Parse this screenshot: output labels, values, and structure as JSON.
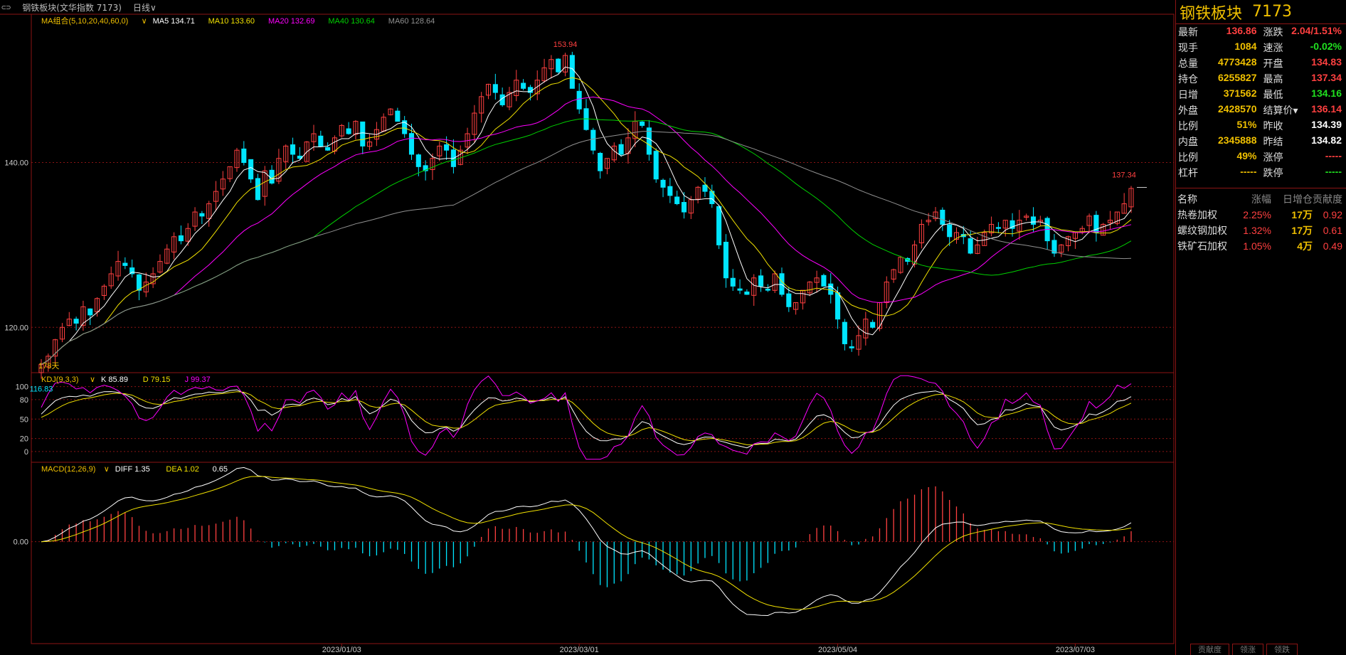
{
  "topbar": {
    "link_icon": "⊂⊃",
    "title": "钢铁板块(文华指数 7173)",
    "period": "日线",
    "period_caret": "∨"
  },
  "colors": {
    "up": "#ff4040",
    "down": "#00e5ff",
    "grid": "#8b1414",
    "ma5": "#ffffff",
    "ma10": "#f0e000",
    "ma20": "#ff00ff",
    "ma40": "#00d000",
    "ma60": "#909090",
    "k": "#ffffff",
    "d": "#f0e000",
    "j": "#ff00ff",
    "diff": "#ffffff",
    "dea": "#f0e000",
    "label_yellow": "#f0c000",
    "label_red": "#ff4040",
    "label_green": "#20e020",
    "label_white": "#ffffff"
  },
  "chart_data": {
    "type": "candlestick",
    "symbol": "钢铁板块",
    "code": "7173",
    "period": "日线",
    "x_ticks": [
      "2023/01/03",
      "2023/03/01",
      "2023/05/04",
      "2023/07/03"
    ],
    "y_ticks": [
      "140.00",
      "120.00"
    ],
    "price_ylim": [
      114.5,
      158
    ],
    "range_label": "178天",
    "annotations": {
      "high": "153.94",
      "low": "116.83",
      "last_high": "137.34"
    },
    "ma_legend": {
      "label": "MA组合(5,10,20,40,60,0)",
      "items": [
        {
          "name": "MA5",
          "value": "134.71",
          "color": "#ffffff"
        },
        {
          "name": "MA10",
          "value": "133.60",
          "color": "#f0e000"
        },
        {
          "name": "MA20",
          "value": "132.69",
          "color": "#ff00ff"
        },
        {
          "name": "MA40",
          "value": "130.64",
          "color": "#00d000"
        },
        {
          "name": "MA60",
          "value": "128.64",
          "color": "#909090"
        }
      ]
    },
    "kdj_legend": {
      "label": "KDJ(9,3,3)",
      "items": [
        {
          "name": "K",
          "value": "85.89",
          "color": "#ffffff"
        },
        {
          "name": "D",
          "value": "79.15",
          "color": "#f0e000"
        },
        {
          "name": "J",
          "value": "99.37",
          "color": "#ff00ff"
        }
      ]
    },
    "kdj_ticks": [
      "100",
      "80",
      "50",
      "20",
      "0"
    ],
    "macd_legend": {
      "label": "MACD(12,26,9)",
      "items": [
        {
          "name": "DIFF",
          "value": "1.35",
          "color": "#ffffff"
        },
        {
          "name": "DEA",
          "value": "1.02",
          "color": "#f0e000"
        },
        {
          "name": "",
          "value": "0.65",
          "color": "#ffffff"
        }
      ]
    },
    "macd_ticks": [
      "0.00"
    ],
    "closes": [
      115.5,
      116.5,
      118.5,
      120.0,
      121.0,
      120.5,
      122.5,
      121.5,
      123.5,
      125.0,
      126.5,
      128.0,
      127.5,
      126.5,
      124.5,
      125.5,
      126.5,
      128.0,
      129.5,
      131.0,
      130.5,
      132.0,
      134.0,
      133.5,
      135.0,
      136.5,
      138.0,
      139.5,
      141.5,
      140.0,
      138.0,
      135.5,
      139.0,
      137.5,
      140.5,
      142.0,
      141.0,
      140.5,
      142.5,
      143.5,
      142.0,
      141.5,
      143.0,
      144.5,
      143.5,
      145.0,
      142.0,
      142.5,
      144.0,
      145.5,
      146.5,
      145.0,
      143.5,
      141.0,
      139.5,
      139.0,
      140.5,
      142.0,
      141.5,
      139.5,
      141.5,
      143.5,
      146.0,
      148.0,
      149.5,
      148.5,
      147.0,
      148.5,
      150.0,
      149.0,
      148.5,
      150.0,
      151.5,
      152.5,
      151.0,
      153.0,
      149.0,
      146.5,
      144.0,
      141.5,
      139.0,
      140.5,
      142.0,
      141.0,
      143.0,
      145.0,
      144.5,
      141.0,
      138.0,
      137.0,
      136.0,
      135.0,
      134.0,
      135.5,
      137.0,
      136.5,
      135.0,
      130.0,
      126.0,
      125.0,
      124.5,
      124.0,
      126.0,
      125.0,
      124.5,
      126.5,
      124.0,
      122.5,
      123.0,
      124.5,
      125.5,
      126.0,
      125.0,
      124.0,
      121.0,
      118.0,
      117.5,
      119.0,
      121.0,
      120.0,
      123.0,
      125.5,
      127.0,
      128.5,
      128.0,
      130.0,
      132.5,
      133.0,
      134.0,
      132.5,
      131.0,
      131.5,
      131.0,
      129.0,
      130.0,
      131.5,
      132.5,
      132.0,
      133.0,
      132.0,
      133.0,
      133.5,
      132.5,
      133.0,
      130.5,
      129.0,
      130.0,
      131.0,
      131.5,
      132.0,
      133.5,
      131.5,
      132.5,
      133.0,
      134.0,
      135.0,
      136.86
    ],
    "kdj_ylim": [
      -10,
      115
    ],
    "macd_ylim": [
      -6.5,
      5.0
    ]
  },
  "quote": {
    "title": "钢铁板块",
    "code": "7173",
    "rows": [
      [
        {
          "k": "最新",
          "v": "136.86",
          "c": "#ff4040"
        },
        {
          "k": "涨跌",
          "v": "2.04/1.51%",
          "c": "#ff4040"
        }
      ],
      [
        {
          "k": "现手",
          "v": "1084",
          "c": "#f0c000"
        },
        {
          "k": "速涨",
          "v": "-0.02%",
          "c": "#20e020"
        }
      ],
      [
        {
          "k": "总量",
          "v": "4773428",
          "c": "#f0c000"
        },
        {
          "k": "开盘",
          "v": "134.83",
          "c": "#ff4040"
        }
      ],
      [
        {
          "k": "持仓",
          "v": "6255827",
          "c": "#f0c000"
        },
        {
          "k": "最高",
          "v": "137.34",
          "c": "#ff4040"
        }
      ],
      [
        {
          "k": "日增",
          "v": "371562",
          "c": "#f0c000"
        },
        {
          "k": "最低",
          "v": "134.16",
          "c": "#20e020"
        }
      ],
      [
        {
          "k": "外盘",
          "v": "2428570",
          "c": "#f0c000"
        },
        {
          "k": "结算价▾",
          "v": "136.14",
          "c": "#ff4040"
        }
      ],
      [
        {
          "k": "比例",
          "v": "51%",
          "c": "#f0c000"
        },
        {
          "k": "昨收",
          "v": "134.39",
          "c": "#ffffff"
        }
      ],
      [
        {
          "k": "内盘",
          "v": "2345888",
          "c": "#f0c000"
        },
        {
          "k": "昨结",
          "v": "134.82",
          "c": "#ffffff"
        }
      ],
      [
        {
          "k": "比例",
          "v": "49%",
          "c": "#f0c000"
        },
        {
          "k": "涨停",
          "v": "-----",
          "c": "#ff4040"
        }
      ],
      [
        {
          "k": "杠杆",
          "v": "-----",
          "c": "#f0c000"
        },
        {
          "k": "跌停",
          "v": "-----",
          "c": "#20e020"
        }
      ]
    ],
    "components_header": [
      "名称",
      "涨幅",
      "日增仓",
      "贡献度"
    ],
    "components": [
      {
        "name": "热卷加权",
        "chg": "2.25%",
        "oi": "17万",
        "contrib": "0.92"
      },
      {
        "name": "螺纹钢加权",
        "chg": "1.32%",
        "oi": "17万",
        "contrib": "0.61"
      },
      {
        "name": "铁矿石加权",
        "chg": "1.05%",
        "oi": "4万",
        "contrib": "0.49"
      }
    ],
    "bottom_tabs": [
      "贡献度",
      "领涨",
      "领跌"
    ]
  }
}
